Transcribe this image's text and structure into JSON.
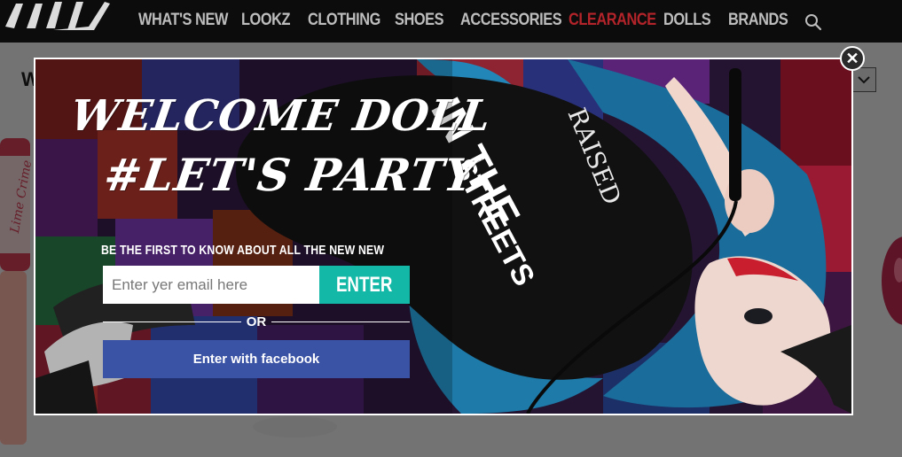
{
  "nav": {
    "items": [
      {
        "label": "WHAT'S NEW"
      },
      {
        "label": "LOOKZ"
      },
      {
        "label": "CLOTHING"
      },
      {
        "label": "SHOES"
      },
      {
        "label": "ACCESSORIES"
      },
      {
        "label": "CLEARANCE"
      },
      {
        "label": "DOLLS"
      },
      {
        "label": "BRANDS"
      }
    ],
    "logo_text": "KILL",
    "search_icon": "search-icon",
    "highlight_color": "#b3242a"
  },
  "page": {
    "heading": "W"
  },
  "popup": {
    "headline_line1": "WELCOME DOLL",
    "headline_line2": "#LET'S PARTY",
    "tagline": "BE THE FIRST TO KNOW ABOUT ALL THE NEW NEW",
    "email_placeholder": "Enter yer email here",
    "enter_label": "ENTER",
    "or_label": "OR",
    "facebook_label": "Enter with facebook",
    "close_icon": "close-icon",
    "enter_color": "#13b8a6",
    "facebook_color": "#3b53a4"
  }
}
